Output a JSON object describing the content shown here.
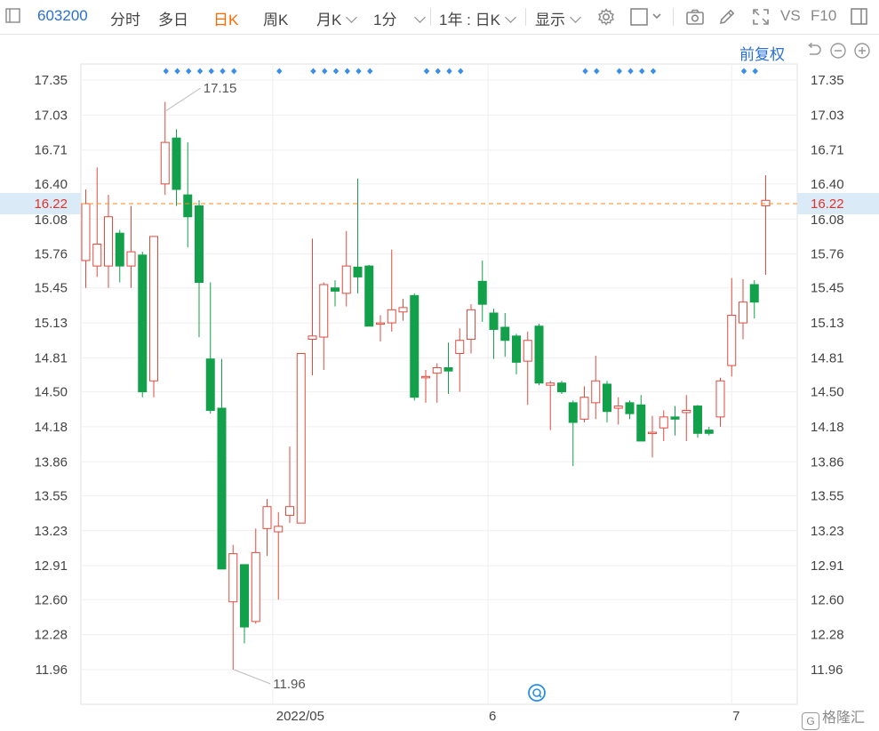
{
  "toolbar": {
    "stock_code": "603200",
    "tabs": [
      "分时",
      "多日",
      "日K",
      "周K"
    ],
    "active_tab": "日K",
    "monthly": "月K",
    "minute": "1分",
    "range": "1年 : 日K",
    "display": "显示",
    "vs_label": "VS",
    "f10_label": "F10",
    "adjust_label": "前复权"
  },
  "icons": [
    "settings-icon",
    "square-icon",
    "camera-icon",
    "pencil-icon",
    "fullscreen-icon",
    "window-icon",
    "undo-icon",
    "zoom-out-icon",
    "zoom-in-icon"
  ],
  "colors": {
    "up": "#e04a3f",
    "down": "#12a04a",
    "current": "#ff8a1e",
    "accent": "#2a6fd6",
    "marker": "#3a8ee6"
  },
  "chart_data": {
    "type": "candlestick",
    "y_ticks": [
      "17.35",
      "17.03",
      "16.71",
      "16.40",
      "16.08",
      "15.76",
      "15.45",
      "15.13",
      "14.81",
      "14.50",
      "14.18",
      "13.86",
      "13.55",
      "13.23",
      "12.91",
      "12.60",
      "12.28",
      "11.96"
    ],
    "x_labels": [
      {
        "label": "2022/05",
        "index": 16.5
      },
      {
        "label": "6",
        "index": 35.5
      },
      {
        "label": "7",
        "index": 57
      }
    ],
    "ylim": [
      11.7,
      17.5
    ],
    "current_price": "16.22",
    "max_label": "17.15",
    "min_label": "11.96",
    "grid": true,
    "candles": [
      {
        "o": 15.7,
        "c": 16.22,
        "h": 16.35,
        "l": 15.45
      },
      {
        "o": 15.65,
        "c": 15.85,
        "h": 16.55,
        "l": 15.55
      },
      {
        "o": 15.65,
        "c": 16.1,
        "h": 16.3,
        "l": 15.45
      },
      {
        "o": 15.95,
        "c": 15.65,
        "h": 15.98,
        "l": 15.5
      },
      {
        "o": 15.65,
        "c": 15.78,
        "h": 16.2,
        "l": 15.45
      },
      {
        "o": 15.75,
        "c": 14.5,
        "h": 15.78,
        "l": 14.45
      },
      {
        "o": 14.6,
        "c": 15.92,
        "h": 15.92,
        "l": 14.45
      },
      {
        "o": 16.4,
        "c": 16.78,
        "h": 17.15,
        "l": 16.3
      },
      {
        "o": 16.82,
        "c": 16.35,
        "h": 16.9,
        "l": 16.2
      },
      {
        "o": 16.3,
        "c": 16.1,
        "h": 16.78,
        "l": 15.82
      },
      {
        "o": 16.2,
        "c": 15.5,
        "h": 16.25,
        "l": 15.0
      },
      {
        "o": 14.8,
        "c": 14.33,
        "h": 15.5,
        "l": 14.3
      },
      {
        "o": 14.35,
        "c": 12.88,
        "h": 14.8,
        "l": 12.88
      },
      {
        "o": 12.58,
        "c": 13.02,
        "h": 13.1,
        "l": 11.96
      },
      {
        "o": 12.92,
        "c": 12.35,
        "h": 12.92,
        "l": 12.2
      },
      {
        "o": 12.4,
        "c": 13.03,
        "h": 13.25,
        "l": 12.38
      },
      {
        "o": 13.25,
        "c": 13.45,
        "h": 13.52,
        "l": 13.0
      },
      {
        "o": 13.22,
        "c": 13.27,
        "h": 13.4,
        "l": 12.6
      },
      {
        "o": 13.37,
        "c": 13.45,
        "h": 14.0,
        "l": 13.3
      },
      {
        "o": 13.3,
        "c": 14.85,
        "h": 14.85,
        "l": 13.3
      },
      {
        "o": 14.98,
        "c": 15.01,
        "h": 15.9,
        "l": 14.65
      },
      {
        "o": 15.0,
        "c": 15.48,
        "h": 15.5,
        "l": 14.7
      },
      {
        "o": 15.45,
        "c": 15.42,
        "h": 15.52,
        "l": 15.28
      },
      {
        "o": 15.4,
        "c": 15.65,
        "h": 15.97,
        "l": 15.28
      },
      {
        "o": 15.64,
        "c": 15.55,
        "h": 16.45,
        "l": 15.4
      },
      {
        "o": 15.65,
        "c": 15.1,
        "h": 15.66,
        "l": 15.1
      },
      {
        "o": 15.12,
        "c": 15.13,
        "h": 15.2,
        "l": 14.96
      },
      {
        "o": 15.13,
        "c": 15.25,
        "h": 15.8,
        "l": 15.05
      },
      {
        "o": 15.23,
        "c": 15.27,
        "h": 15.35,
        "l": 15.15
      },
      {
        "o": 15.38,
        "c": 14.45,
        "h": 15.4,
        "l": 14.42
      },
      {
        "o": 14.63,
        "c": 14.64,
        "h": 14.7,
        "l": 14.4
      },
      {
        "o": 14.67,
        "c": 14.72,
        "h": 14.76,
        "l": 14.4
      },
      {
        "o": 14.72,
        "c": 14.69,
        "h": 14.95,
        "l": 14.48
      },
      {
        "o": 14.85,
        "c": 14.97,
        "h": 15.08,
        "l": 14.5
      },
      {
        "o": 14.98,
        "c": 15.25,
        "h": 15.3,
        "l": 14.85
      },
      {
        "o": 15.51,
        "c": 15.3,
        "h": 15.7,
        "l": 15.14
      },
      {
        "o": 15.22,
        "c": 15.07,
        "h": 15.26,
        "l": 14.8
      },
      {
        "o": 15.09,
        "c": 14.97,
        "h": 15.22,
        "l": 14.82
      },
      {
        "o": 15.01,
        "c": 14.77,
        "h": 15.03,
        "l": 14.66
      },
      {
        "o": 14.78,
        "c": 14.97,
        "h": 15.05,
        "l": 14.38
      },
      {
        "o": 15.1,
        "c": 14.58,
        "h": 15.12,
        "l": 14.56
      },
      {
        "o": 14.56,
        "c": 14.58,
        "h": 14.6,
        "l": 14.15
      },
      {
        "o": 14.58,
        "c": 14.5,
        "h": 14.6,
        "l": 14.48
      },
      {
        "o": 14.4,
        "c": 14.22,
        "h": 14.42,
        "l": 13.82
      },
      {
        "o": 14.25,
        "c": 14.45,
        "h": 14.55,
        "l": 14.22
      },
      {
        "o": 14.4,
        "c": 14.6,
        "h": 14.83,
        "l": 14.25
      },
      {
        "o": 14.57,
        "c": 14.32,
        "h": 14.6,
        "l": 14.22
      },
      {
        "o": 14.35,
        "c": 14.37,
        "h": 14.45,
        "l": 14.2
      },
      {
        "o": 14.4,
        "c": 14.3,
        "h": 14.42,
        "l": 14.25
      },
      {
        "o": 14.38,
        "c": 14.05,
        "h": 14.47,
        "l": 14.05
      },
      {
        "o": 14.12,
        "c": 14.13,
        "h": 14.28,
        "l": 13.9
      },
      {
        "o": 14.17,
        "c": 14.27,
        "h": 14.33,
        "l": 14.05
      },
      {
        "o": 14.27,
        "c": 14.25,
        "h": 14.37,
        "l": 14.1
      },
      {
        "o": 14.31,
        "c": 14.33,
        "h": 14.47,
        "l": 14.05
      },
      {
        "o": 14.37,
        "c": 14.12,
        "h": 14.38,
        "l": 14.08
      },
      {
        "o": 14.15,
        "c": 14.12,
        "h": 14.18,
        "l": 14.1
      },
      {
        "o": 14.27,
        "c": 14.6,
        "h": 14.63,
        "l": 14.18
      },
      {
        "o": 14.74,
        "c": 15.2,
        "h": 15.54,
        "l": 14.64
      },
      {
        "o": 15.13,
        "c": 15.32,
        "h": 15.53,
        "l": 14.98
      },
      {
        "o": 15.48,
        "c": 15.32,
        "h": 15.52,
        "l": 15.17
      },
      {
        "o": 16.2,
        "c": 16.25,
        "h": 16.48,
        "l": 15.57
      }
    ],
    "markers": [
      {
        "from": 7,
        "to": 11
      },
      {
        "from": 12,
        "to": 13
      },
      {
        "from": 17,
        "to": 17
      },
      {
        "from": 20,
        "to": 25
      },
      {
        "from": 30,
        "to": 33
      },
      {
        "from": 44,
        "to": 45
      },
      {
        "from": 47,
        "to": 50
      },
      {
        "from": 58,
        "to": 59
      }
    ]
  }
}
